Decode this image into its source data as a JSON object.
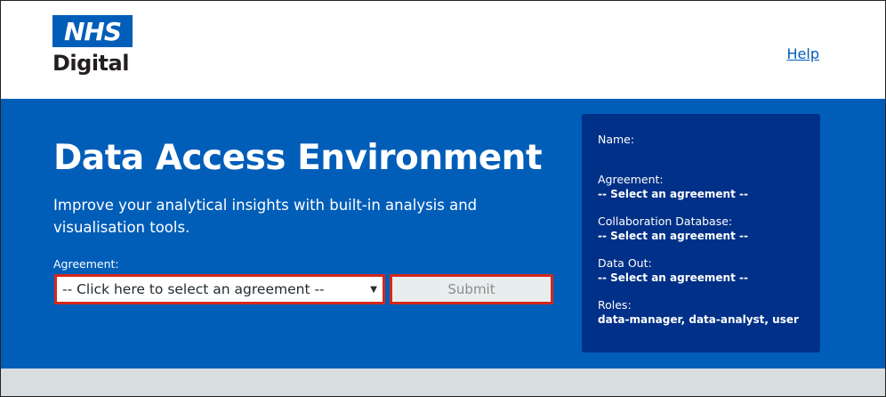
{
  "header": {
    "logo_top": "NHS",
    "logo_bottom": "Digital",
    "help_link": "Help"
  },
  "hero": {
    "title": "Data Access Environment",
    "description": "Improve your analytical insights with built-in analysis and visualisation tools.",
    "agreement_label": "Agreement:",
    "agreement_select_value": "-- Click here to select an agreement --",
    "submit_label": "Submit"
  },
  "info_panel": {
    "name_label": "Name:",
    "name_value": "",
    "agreement_label": "Agreement:",
    "agreement_value": "-- Select an agreement --",
    "collab_label": "Collaboration Database:",
    "collab_value": "-- Select an agreement --",
    "data_out_label": "Data Out:",
    "data_out_value": "-- Select an agreement --",
    "roles_label": "Roles:",
    "roles_value": "data-manager, data-analyst, user"
  },
  "colors": {
    "nhs_blue": "#005eb8",
    "panel_dark_blue": "#003087",
    "highlight_red": "#d5281b"
  },
  "icons": {
    "select_arrow": "caret-down-icon"
  }
}
